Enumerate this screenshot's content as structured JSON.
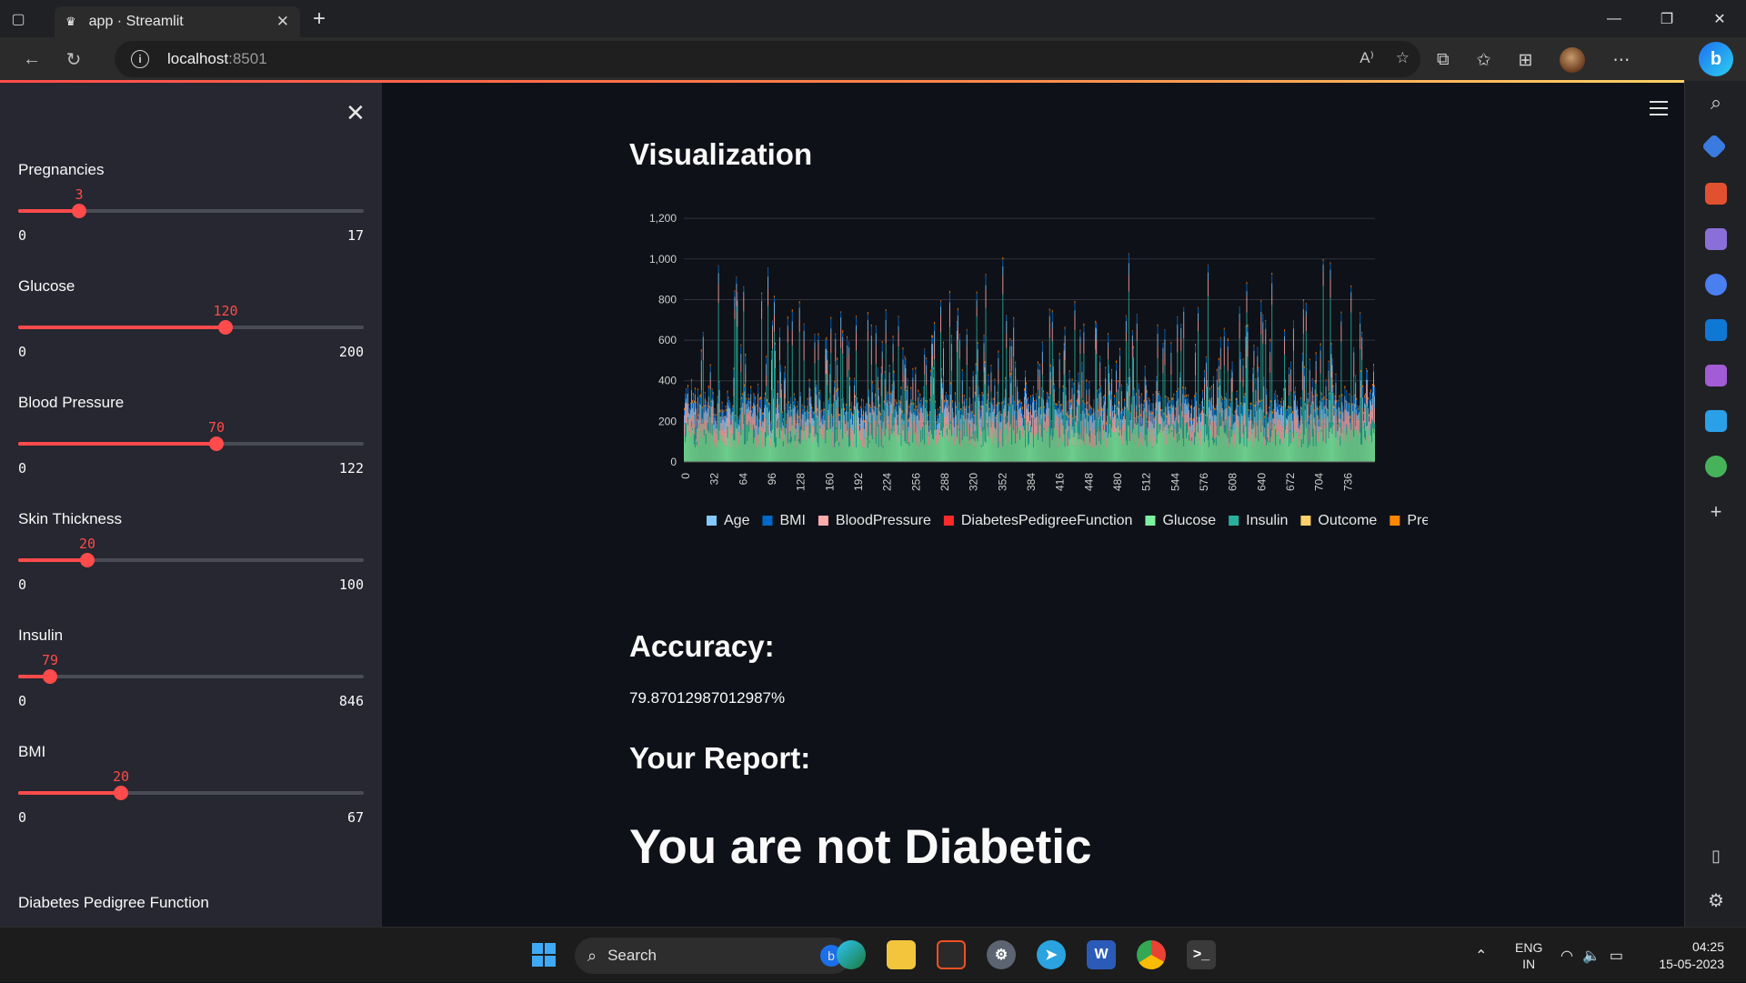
{
  "browser": {
    "tab_title": "app · Streamlit",
    "url_host": "localhost",
    "url_port": ":8501"
  },
  "sidebar": {
    "sliders": [
      {
        "label": "Pregnancies",
        "value": "3",
        "min": "0",
        "max": "17"
      },
      {
        "label": "Glucose",
        "value": "120",
        "min": "0",
        "max": "200"
      },
      {
        "label": "Blood Pressure",
        "value": "70",
        "min": "0",
        "max": "122"
      },
      {
        "label": "Skin Thickness",
        "value": "20",
        "min": "0",
        "max": "100"
      },
      {
        "label": "Insulin",
        "value": "79",
        "min": "0",
        "max": "846"
      },
      {
        "label": "BMI",
        "value": "20",
        "min": "0",
        "max": "67"
      }
    ],
    "next_label": "Diabetes Pedigree Function"
  },
  "main": {
    "visualization_heading": "Visualization",
    "accuracy_heading": "Accuracy:",
    "accuracy_value": "79.87012987012987%",
    "report_heading": "Your Report:",
    "result_text": "You are not Diabetic"
  },
  "chart_data": {
    "type": "bar",
    "stacked": true,
    "ylim": [
      0,
      1250
    ],
    "yticks": [
      "0",
      "200",
      "400",
      "600",
      "800",
      "1,000",
      "1,200"
    ],
    "xticks": [
      "0",
      "32",
      "64",
      "96",
      "128",
      "160",
      "192",
      "224",
      "256",
      "288",
      "320",
      "352",
      "384",
      "416",
      "448",
      "480",
      "512",
      "544",
      "576",
      "608",
      "640",
      "672",
      "704",
      "736"
    ],
    "n_records": 768,
    "legend_position": "bottom",
    "series": [
      {
        "name": "Age",
        "color": "#83c9ff"
      },
      {
        "name": "BMI",
        "color": "#0068c9"
      },
      {
        "name": "BloodPressure",
        "color": "#ffabab"
      },
      {
        "name": "DiabetesPedigreeFunction",
        "color": "#ff2b2b"
      },
      {
        "name": "Glucose",
        "color": "#7defa1"
      },
      {
        "name": "Insulin",
        "color": "#29b09d"
      },
      {
        "name": "Outcome",
        "color": "#ffd16a"
      },
      {
        "name": "Preg",
        "color": "#ff8700"
      }
    ]
  },
  "taskbar": {
    "search_label": "Search",
    "lang_primary": "ENG",
    "lang_secondary": "IN",
    "time": "04:25",
    "date": "15-05-2023"
  }
}
